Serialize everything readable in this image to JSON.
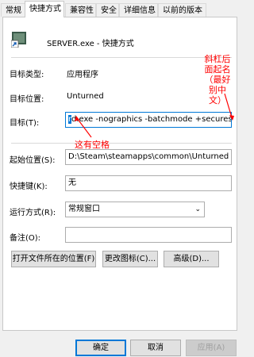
{
  "tabs": [
    "常规",
    "快捷方式",
    "兼容性",
    "安全",
    "详细信息",
    "以前的版本"
  ],
  "header": {
    "title": "SERVER.exe - 快捷方式",
    "icon": "shortcut-app-icon"
  },
  "info": {
    "type_label": "目标类型:",
    "type_value": "应用程序",
    "location_label": "目标位置:",
    "location_value": "Unturned"
  },
  "target": {
    "label": "目标(T):",
    "value_plain": "",
    "value_selected": "r",
    "value_rest": "d.exe -nographics -batchmode +secureserver/"
  },
  "start_in": {
    "label": "起始位置(S):",
    "value": "D:\\Steam\\steamapps\\common\\Unturned"
  },
  "hotkey": {
    "label": "快捷键(K):",
    "value": "无"
  },
  "run": {
    "label": "运行方式(R):",
    "value": "常规窗口"
  },
  "comment": {
    "label": "备注(O):",
    "value": ""
  },
  "buttons": {
    "open_location": "打开文件所在的位置(F)",
    "change_icon": "更改图标(C)...",
    "advanced": "高级(D)..."
  },
  "footer": {
    "ok": "确定",
    "cancel": "取消",
    "apply": "应用(A)"
  },
  "annotations": {
    "space_note": "这有空格",
    "side_note_lines": [
      "斜杠后",
      "面起名",
      "（最好",
      "别中",
      "文）"
    ]
  },
  "colors": {
    "annotation": "#ff0000",
    "focus": "#0078d7"
  }
}
